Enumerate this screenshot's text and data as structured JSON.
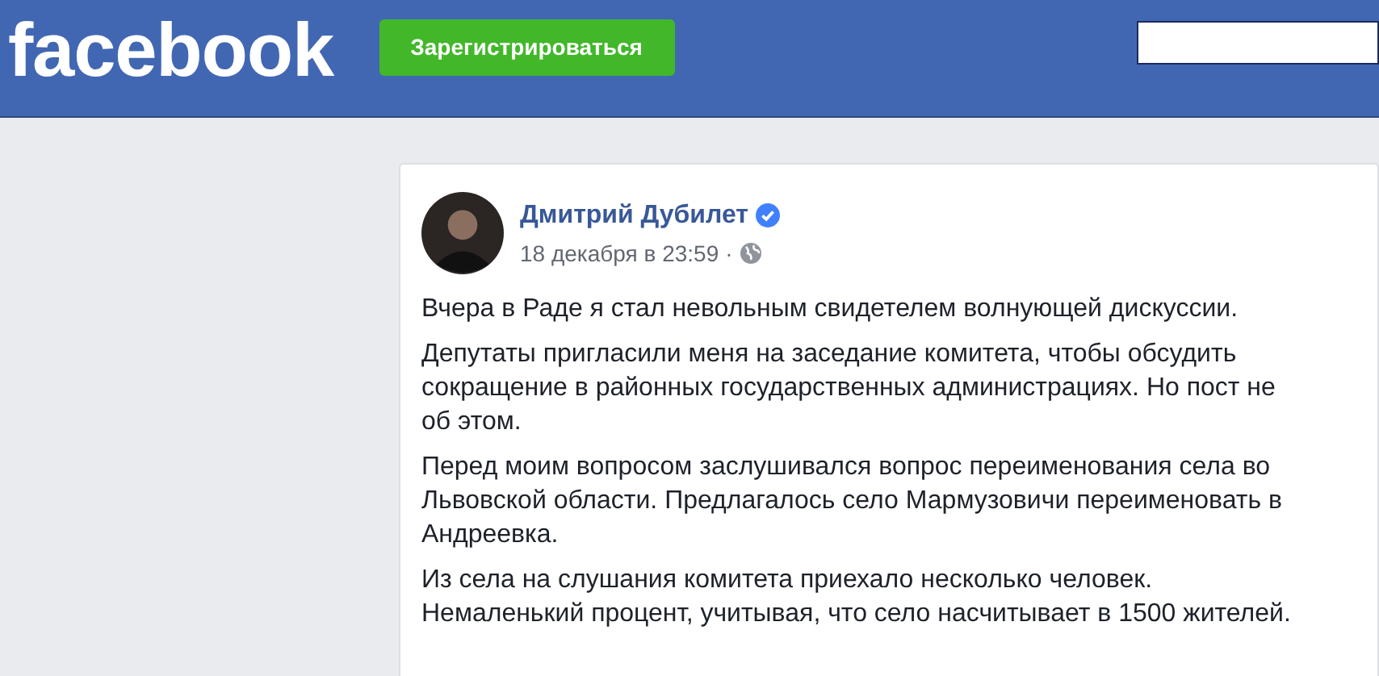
{
  "header": {
    "logo": "facebook",
    "signup_button": "Зарегистрироваться"
  },
  "post": {
    "author": "Дмитрий Дубилет",
    "verified": true,
    "date": "18 декабря в 23:59",
    "separator": "·",
    "paragraphs": [
      [
        "Вчера в Раде я стал невольным свидетелем волнующей дискуссии."
      ],
      [
        "Депутаты пригласили меня на заседание комитета, чтобы обсудить",
        "сокращение в районных государственных администрациях. Но пост не",
        "об этом."
      ],
      [
        "Перед моим вопросом заслушивался вопрос переименования села во",
        "Львовской области. Предлагалось село Мармузовичи переименовать в",
        "Андреевка."
      ],
      [
        "Из села на слушания комитета приехало несколько человек.",
        "Немаленький процент, учитывая, что село насчитывает в 1500 жителей."
      ]
    ]
  }
}
